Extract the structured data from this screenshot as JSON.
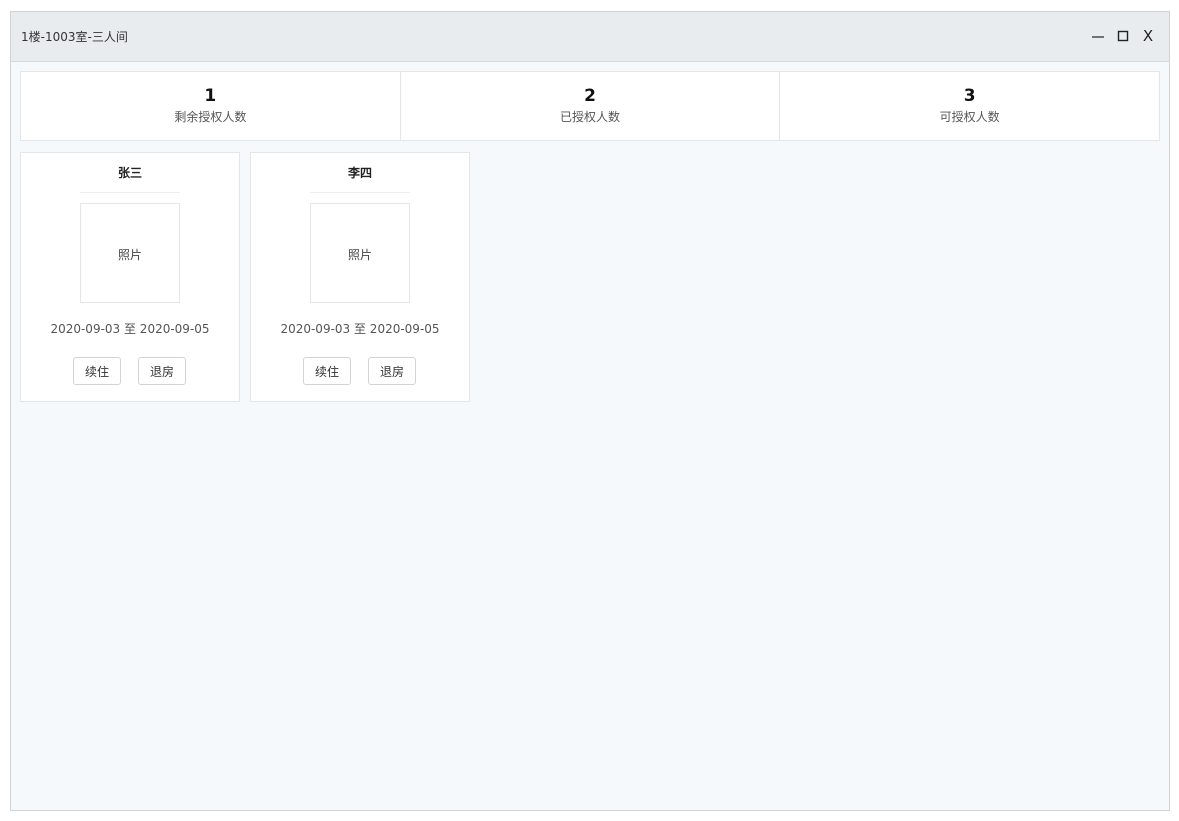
{
  "window": {
    "title": "1楼-1003室-三人间",
    "controls": {
      "minimize_icon": "minimize-icon",
      "maximize_icon": "maximize-icon",
      "close_label": "X"
    }
  },
  "stats": [
    {
      "value": "1",
      "label": "剩余授权人数"
    },
    {
      "value": "2",
      "label": "已授权人数"
    },
    {
      "value": "3",
      "label": "可授权人数"
    }
  ],
  "guests": [
    {
      "name": "张三",
      "photo_placeholder": "照片",
      "dates": "2020-09-03 至 2020-09-05",
      "renew_label": "续住",
      "checkout_label": "退房"
    },
    {
      "name": "李四",
      "photo_placeholder": "照片",
      "dates": "2020-09-03 至 2020-09-05",
      "renew_label": "续住",
      "checkout_label": "退房"
    }
  ]
}
